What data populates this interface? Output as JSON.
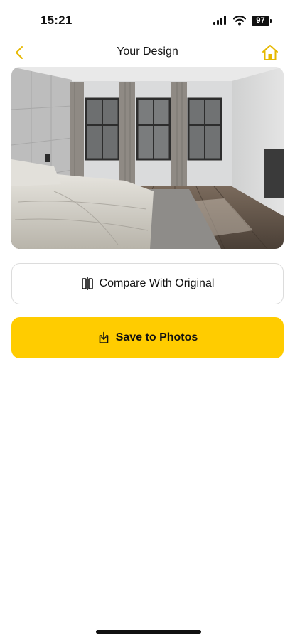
{
  "status_bar": {
    "time": "15:21",
    "battery_level": "97",
    "icons": [
      "cellular-signal-icon",
      "wifi-icon",
      "battery-icon"
    ]
  },
  "nav": {
    "title": "Your Design",
    "back_icon": "chevron-left-icon",
    "home_icon": "home-icon"
  },
  "actions": {
    "compare_label": "Compare With Original",
    "compare_icon": "compare-split-icon",
    "save_label": "Save to Photos",
    "save_icon": "save-download-icon"
  },
  "colors": {
    "accent": "#FFCC00",
    "nav_icon": "#E6B800",
    "text": "#111111",
    "border": "#DCDCDC"
  }
}
